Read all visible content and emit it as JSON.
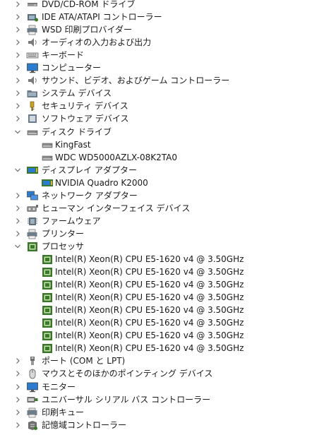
{
  "colors": {
    "chevron": "#6a6a6a",
    "text": "#1a1a1a",
    "chip": "#3b7a2a",
    "monitor": "#2b7bd1"
  },
  "rows": [
    {
      "label": "DVD/CD-ROM ドライブ",
      "level": 0,
      "state": "collapsed",
      "icon": "dvd-drive-icon"
    },
    {
      "label": "IDE ATA/ATAPI コントローラー",
      "level": 0,
      "state": "collapsed",
      "icon": "ide-controller-icon"
    },
    {
      "label": "WSD 印刷プロバイダー",
      "level": 0,
      "state": "collapsed",
      "icon": "printer-icon"
    },
    {
      "label": "オーディオの入力および出力",
      "level": 0,
      "state": "collapsed",
      "icon": "speaker-icon"
    },
    {
      "label": "キーボード",
      "level": 0,
      "state": "collapsed",
      "icon": "keyboard-icon"
    },
    {
      "label": "コンピューター",
      "level": 0,
      "state": "collapsed",
      "icon": "monitor-icon"
    },
    {
      "label": "サウンド、ビデオ、およびゲーム コントローラー",
      "level": 0,
      "state": "collapsed",
      "icon": "speaker-icon"
    },
    {
      "label": "システム デバイス",
      "level": 0,
      "state": "collapsed",
      "icon": "system-folder-icon"
    },
    {
      "label": "セキュリティ デバイス",
      "level": 0,
      "state": "collapsed",
      "icon": "security-key-icon"
    },
    {
      "label": "ソフトウェア デバイス",
      "level": 0,
      "state": "collapsed",
      "icon": "software-device-icon"
    },
    {
      "label": "ディスク ドライブ",
      "level": 0,
      "state": "expanded",
      "icon": "disk-drive-icon"
    },
    {
      "label": "KingFast",
      "level": 1,
      "state": "leaf",
      "icon": "disk-drive-icon"
    },
    {
      "label": "WDC WD5000AZLX-08K2TA0",
      "level": 1,
      "state": "leaf",
      "icon": "disk-drive-icon"
    },
    {
      "label": "ディスプレイ アダプター",
      "level": 0,
      "state": "expanded",
      "icon": "display-adapter-icon"
    },
    {
      "label": "NVIDIA Quadro K2000",
      "level": 1,
      "state": "leaf",
      "icon": "display-adapter-icon"
    },
    {
      "label": "ネットワーク アダプター",
      "level": 0,
      "state": "collapsed",
      "icon": "network-adapter-icon"
    },
    {
      "label": "ヒューマン インターフェイス デバイス",
      "level": 0,
      "state": "collapsed",
      "icon": "hid-icon"
    },
    {
      "label": "ファームウェア",
      "level": 0,
      "state": "collapsed",
      "icon": "firmware-icon"
    },
    {
      "label": "プリンター",
      "level": 0,
      "state": "collapsed",
      "icon": "printer-icon"
    },
    {
      "label": "プロセッサ",
      "level": 0,
      "state": "expanded",
      "icon": "processor-icon"
    },
    {
      "label": "Intel(R) Xeon(R) CPU E5-1620 v4 @ 3.50GHz",
      "level": 1,
      "state": "leaf",
      "icon": "processor-icon"
    },
    {
      "label": "Intel(R) Xeon(R) CPU E5-1620 v4 @ 3.50GHz",
      "level": 1,
      "state": "leaf",
      "icon": "processor-icon"
    },
    {
      "label": "Intel(R) Xeon(R) CPU E5-1620 v4 @ 3.50GHz",
      "level": 1,
      "state": "leaf",
      "icon": "processor-icon"
    },
    {
      "label": "Intel(R) Xeon(R) CPU E5-1620 v4 @ 3.50GHz",
      "level": 1,
      "state": "leaf",
      "icon": "processor-icon"
    },
    {
      "label": "Intel(R) Xeon(R) CPU E5-1620 v4 @ 3.50GHz",
      "level": 1,
      "state": "leaf",
      "icon": "processor-icon"
    },
    {
      "label": "Intel(R) Xeon(R) CPU E5-1620 v4 @ 3.50GHz",
      "level": 1,
      "state": "leaf",
      "icon": "processor-icon"
    },
    {
      "label": "Intel(R) Xeon(R) CPU E5-1620 v4 @ 3.50GHz",
      "level": 1,
      "state": "leaf",
      "icon": "processor-icon"
    },
    {
      "label": "Intel(R) Xeon(R) CPU E5-1620 v4 @ 3.50GHz",
      "level": 1,
      "state": "leaf",
      "icon": "processor-icon"
    },
    {
      "label": "ポート (COM と LPT)",
      "level": 0,
      "state": "collapsed",
      "icon": "port-icon"
    },
    {
      "label": "マウスとそのほかのポインティング デバイス",
      "level": 0,
      "state": "collapsed",
      "icon": "mouse-icon"
    },
    {
      "label": "モニター",
      "level": 0,
      "state": "collapsed",
      "icon": "monitor-icon"
    },
    {
      "label": "ユニバーサル シリアル バス コントローラー",
      "level": 0,
      "state": "collapsed",
      "icon": "usb-controller-icon"
    },
    {
      "label": "印刷キュー",
      "level": 0,
      "state": "collapsed",
      "icon": "print-queue-icon"
    },
    {
      "label": "記憶域コントローラー",
      "level": 0,
      "state": "collapsed",
      "icon": "storage-controller-icon"
    }
  ]
}
